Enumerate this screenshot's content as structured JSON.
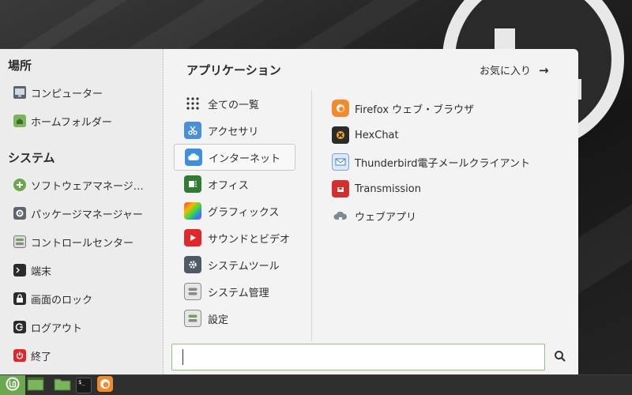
{
  "sidebar": {
    "places_heading": "場所",
    "places": [
      {
        "label": "コンピューター",
        "icon": "computer-icon"
      },
      {
        "label": "ホームフォルダー",
        "icon": "home-folder-icon"
      }
    ],
    "system_heading": "システム",
    "system": [
      {
        "label": "ソフトウェアマネージ…",
        "icon": "software-manager-icon"
      },
      {
        "label": "パッケージマネージャー",
        "icon": "package-manager-icon"
      },
      {
        "label": "コントロールセンター",
        "icon": "control-center-icon"
      },
      {
        "label": "端末",
        "icon": "terminal-icon"
      },
      {
        "label": "画面のロック",
        "icon": "lock-icon"
      },
      {
        "label": "ログアウト",
        "icon": "logout-icon"
      },
      {
        "label": "終了",
        "icon": "power-icon"
      }
    ]
  },
  "main": {
    "title": "アプリケーション",
    "favorites_label": "お気に入り",
    "favorites_arrow": "→",
    "categories": [
      {
        "label": "全ての一覧",
        "icon": "grid-icon"
      },
      {
        "label": "アクセサリ",
        "icon": "scissors-icon"
      },
      {
        "label": "インターネット",
        "icon": "cloud-icon",
        "selected": true
      },
      {
        "label": "オフィス",
        "icon": "office-icon"
      },
      {
        "label": "グラフィックス",
        "icon": "graphics-icon"
      },
      {
        "label": "サウンドとビデオ",
        "icon": "play-icon"
      },
      {
        "label": "システムツール",
        "icon": "gear-icon"
      },
      {
        "label": "システム管理",
        "icon": "toggle-icon"
      },
      {
        "label": "設定",
        "icon": "settings-toggle-icon"
      }
    ],
    "apps": [
      {
        "label": "Firefox ウェブ・ブラウザ",
        "icon": "firefox-icon"
      },
      {
        "label": "HexChat",
        "icon": "hexchat-icon"
      },
      {
        "label": "Thunderbird電子メールクライアント",
        "icon": "thunderbird-icon"
      },
      {
        "label": "Transmission",
        "icon": "transmission-icon"
      },
      {
        "label": "ウェブアプリ",
        "icon": "webapp-icon"
      }
    ]
  },
  "search": {
    "value": "",
    "placeholder": ""
  },
  "taskbar": {
    "terminal_glyph": "$_",
    "items": [
      "menu-icon",
      "show-desktop-icon",
      "files-icon",
      "terminal-icon",
      "firefox-icon"
    ]
  },
  "colors": {
    "accent": "#8fc27a",
    "mint_green": "#6aa84f",
    "menu_bg": "#f3f3f3",
    "taskbar_bg": "#2f2f2f"
  }
}
